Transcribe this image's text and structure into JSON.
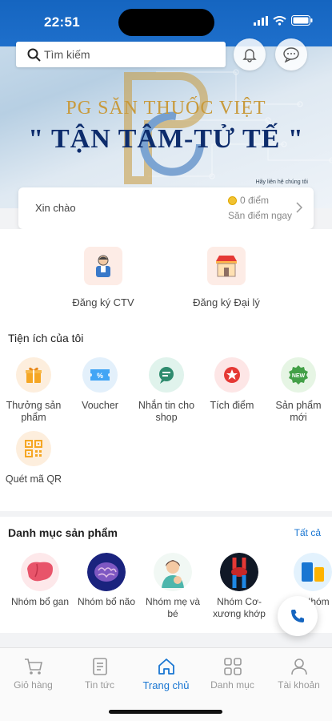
{
  "status": {
    "time": "22:51"
  },
  "search": {
    "placeholder": "Tìm kiếm"
  },
  "banner": {
    "brand": "PG SĂN THUỐC VIỆT",
    "slogan": "\" TẬN TÂM-TỬ TẾ \"",
    "small_text": "Hãy liên hệ chúng tôi"
  },
  "greeting": {
    "hello": "Xin chào",
    "points": "0 điểm",
    "hunt": "Săn điểm ngay"
  },
  "register": [
    {
      "label": "Đăng ký CTV",
      "icon": "collaborator-icon"
    },
    {
      "label": "Đăng ký Đại lý",
      "icon": "store-icon"
    }
  ],
  "utilities": {
    "title": "Tiện ích của tôi",
    "items": [
      {
        "label": "Thưởng sản phẩm",
        "icon": "gift-icon",
        "color": "#fdeedd"
      },
      {
        "label": "Voucher",
        "icon": "voucher-icon",
        "color": "#e3f0fb"
      },
      {
        "label": "Nhắn tin cho shop",
        "icon": "chat-icon",
        "color": "#e0f3ec"
      },
      {
        "label": "Tích điểm",
        "icon": "star-icon",
        "color": "#fde6e6"
      },
      {
        "label": "Sản phẩm mới",
        "icon": "new-badge-icon",
        "color": "#e6f5e4"
      },
      {
        "label": "Quét mã QR",
        "icon": "qr-icon",
        "color": "#fdeedd"
      }
    ]
  },
  "categories": {
    "title": "Danh mục sản phẩm",
    "see_all": "Tất cả",
    "items": [
      {
        "label": "Nhóm bổ gan"
      },
      {
        "label": "Nhóm bổ não"
      },
      {
        "label": "Nhóm mẹ và bé"
      },
      {
        "label": "Nhóm Cơ-xương khớp"
      },
      {
        "label": "Nhóm bổ"
      }
    ]
  },
  "nav": {
    "items": [
      {
        "label": "Giỏ hàng",
        "icon": "cart-icon"
      },
      {
        "label": "Tin tức",
        "icon": "news-icon"
      },
      {
        "label": "Trang chủ",
        "icon": "home-icon",
        "active": true
      },
      {
        "label": "Danh mục",
        "icon": "grid-icon"
      },
      {
        "label": "Tài khoản",
        "icon": "user-icon"
      }
    ]
  },
  "colors": {
    "primary": "#1976d2",
    "header": "#1565c0",
    "accent": "#e53935"
  }
}
